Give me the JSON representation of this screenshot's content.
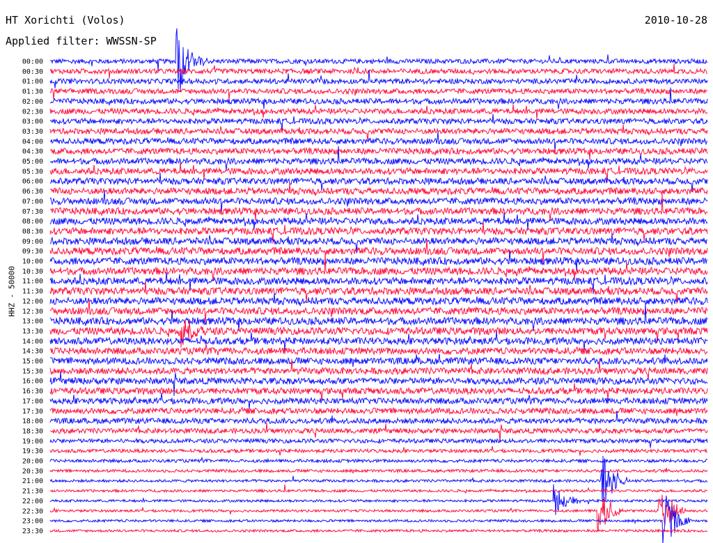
{
  "header": {
    "title": "HT Xorichti (Volos)",
    "filter": "Applied filter: WWSSN-SP",
    "date": "2010-10-28"
  },
  "chart_data": {
    "type": "line",
    "title": "HT Xorichti (Volos)",
    "subtitle": "Applied filter: WWSSN-SP",
    "date": "2010-10-28",
    "ylabel": "HHZ - 50000",
    "row_labels": [
      "00:00",
      "00:30",
      "01:00",
      "01:30",
      "02:00",
      "02:30",
      "03:00",
      "03:30",
      "04:00",
      "04:30",
      "05:00",
      "05:30",
      "06:00",
      "06:30",
      "07:00",
      "07:30",
      "08:00",
      "08:30",
      "09:00",
      "09:30",
      "10:00",
      "10:30",
      "11:00",
      "11:30",
      "12:00",
      "12:30",
      "13:00",
      "13:30",
      "14:00",
      "14:30",
      "15:00",
      "15:30",
      "16:00",
      "16:30",
      "17:00",
      "17:30",
      "18:00",
      "18:30",
      "19:00",
      "19:30",
      "20:00",
      "20:30",
      "21:00",
      "21:30",
      "22:00",
      "22:30",
      "23:00",
      "23:30"
    ],
    "series_colors": [
      "#1010ff",
      "#ff1040"
    ],
    "noise_level": [
      0.55,
      0.6,
      0.6,
      0.62,
      0.65,
      0.65,
      0.65,
      0.68,
      0.7,
      0.72,
      0.72,
      0.75,
      0.75,
      0.78,
      0.78,
      0.8,
      0.8,
      0.82,
      0.82,
      0.85,
      0.85,
      0.85,
      0.85,
      0.85,
      0.85,
      0.85,
      0.85,
      0.85,
      0.82,
      0.8,
      0.8,
      0.78,
      0.78,
      0.75,
      0.72,
      0.7,
      0.65,
      0.6,
      0.5,
      0.42,
      0.38,
      0.35,
      0.32,
      0.3,
      0.3,
      0.3,
      0.3,
      0.3
    ],
    "events": [
      {
        "row": 0,
        "minute": 5.8,
        "strength": 1.0
      },
      {
        "row": 27,
        "minute": 6.0,
        "strength": 0.6
      },
      {
        "row": 42,
        "minute": 25.2,
        "strength": 0.8
      },
      {
        "row": 44,
        "minute": 23.0,
        "strength": 0.5
      },
      {
        "row": 45,
        "minute": 25.0,
        "strength": 0.7
      },
      {
        "row": 45,
        "minute": 27.8,
        "strength": 1.0
      },
      {
        "row": 46,
        "minute": 28.0,
        "strength": 0.9
      }
    ],
    "grid": false,
    "legend": "none"
  }
}
